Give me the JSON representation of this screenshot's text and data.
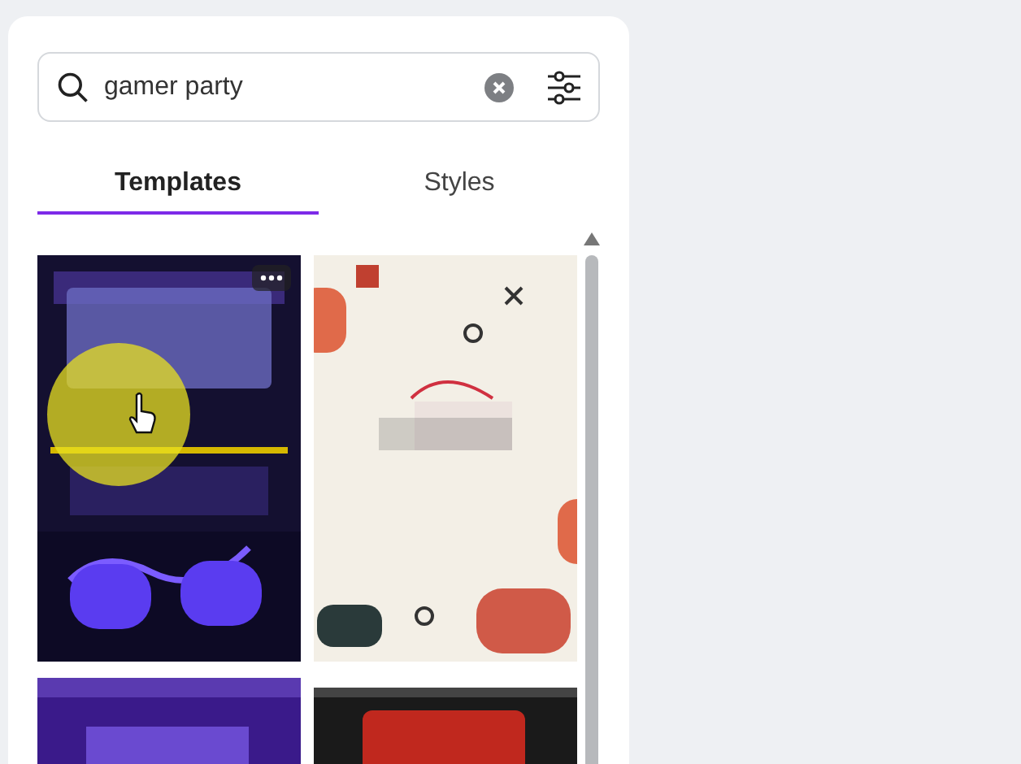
{
  "search": {
    "value": "gamer party"
  },
  "tabs": [
    {
      "label": "Templates",
      "selected": true
    },
    {
      "label": "Styles",
      "selected": false
    }
  ],
  "templates": [
    {
      "kind": "picture",
      "hovered": true
    },
    {
      "kind": "picture",
      "hovered": false
    },
    {
      "kind": "picture",
      "hovered": false
    },
    {
      "kind": "picture",
      "hovered": false
    }
  ]
}
